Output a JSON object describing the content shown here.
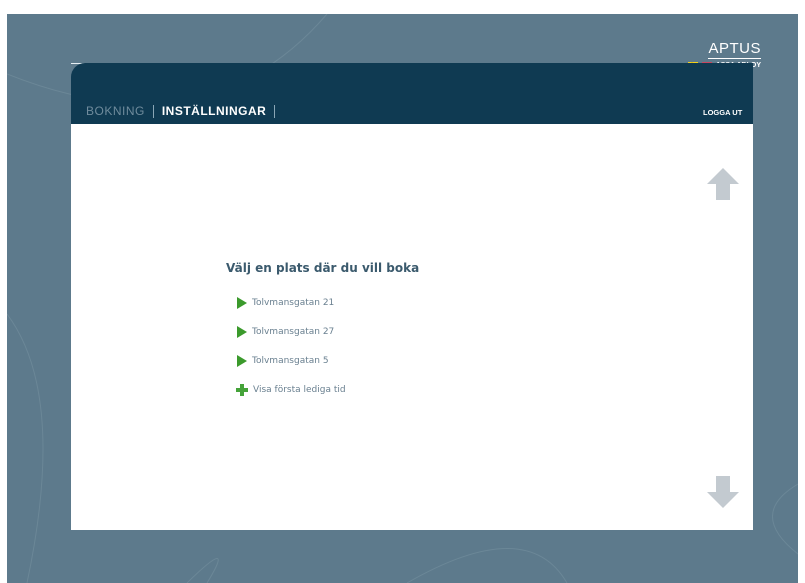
{
  "brand": {
    "logo": "APTUS",
    "company": "ASSA ABLOY",
    "languages": [
      "flag-sweden-icon",
      "flag-uk-icon"
    ]
  },
  "nav": {
    "tabs": [
      {
        "label": "BOKNING",
        "active": false
      },
      {
        "label": "INSTÄLLNINGAR",
        "active": true
      }
    ],
    "logout_label": "LOGGA UT"
  },
  "main": {
    "heading": "Välj en plats där du vill boka",
    "locations": [
      {
        "label": "Tolvmansgatan 21",
        "icon": "play-arrow-icon"
      },
      {
        "label": "Tolvmansgatan 27",
        "icon": "play-arrow-icon"
      },
      {
        "label": "Tolvmansgatan 5",
        "icon": "play-arrow-icon"
      }
    ],
    "first_available": {
      "label": "Visa första lediga tid",
      "icon": "green-plus-icon"
    }
  },
  "scroll": {
    "up_icon": "arrow-up-icon",
    "down_icon": "arrow-down-icon"
  },
  "colors": {
    "background": "#5d7a8c",
    "header": "#0f3a52",
    "play_green": "#3b9a2c",
    "plus_green": "#45a33a",
    "arrow_gray": "#c3cad0"
  }
}
